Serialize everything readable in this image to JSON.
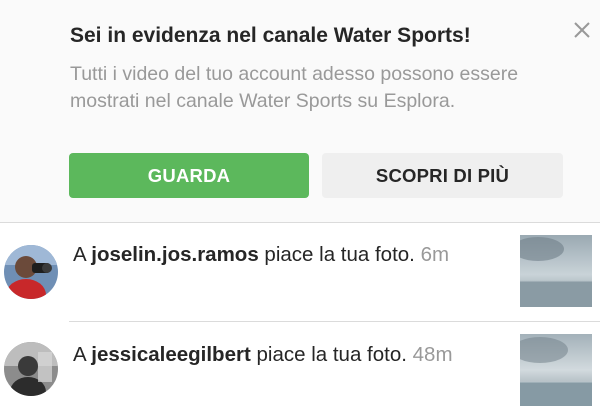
{
  "banner": {
    "title": "Sei in evidenza nel canale Water Sports!",
    "description": "Tutti i video del tuo account adesso possono essere mostrati nel canale Water Sports su Esplora.",
    "primary_button": "GUARDA",
    "secondary_button": "SCOPRI DI PIÙ",
    "close_icon": "close-icon"
  },
  "notifications": [
    {
      "prefix": "A ",
      "username": "joselin.jos.ramos",
      "action": " piace la tua foto.",
      "time": "6m"
    },
    {
      "prefix": "A ",
      "username": "jessicaleegilbert",
      "action": " piace la tua foto.",
      "time": "48m"
    }
  ],
  "colors": {
    "primary_green": "#5cb85c",
    "secondary_button_bg": "#efefef",
    "muted_text": "#999999",
    "banner_bg": "#fafafa"
  }
}
